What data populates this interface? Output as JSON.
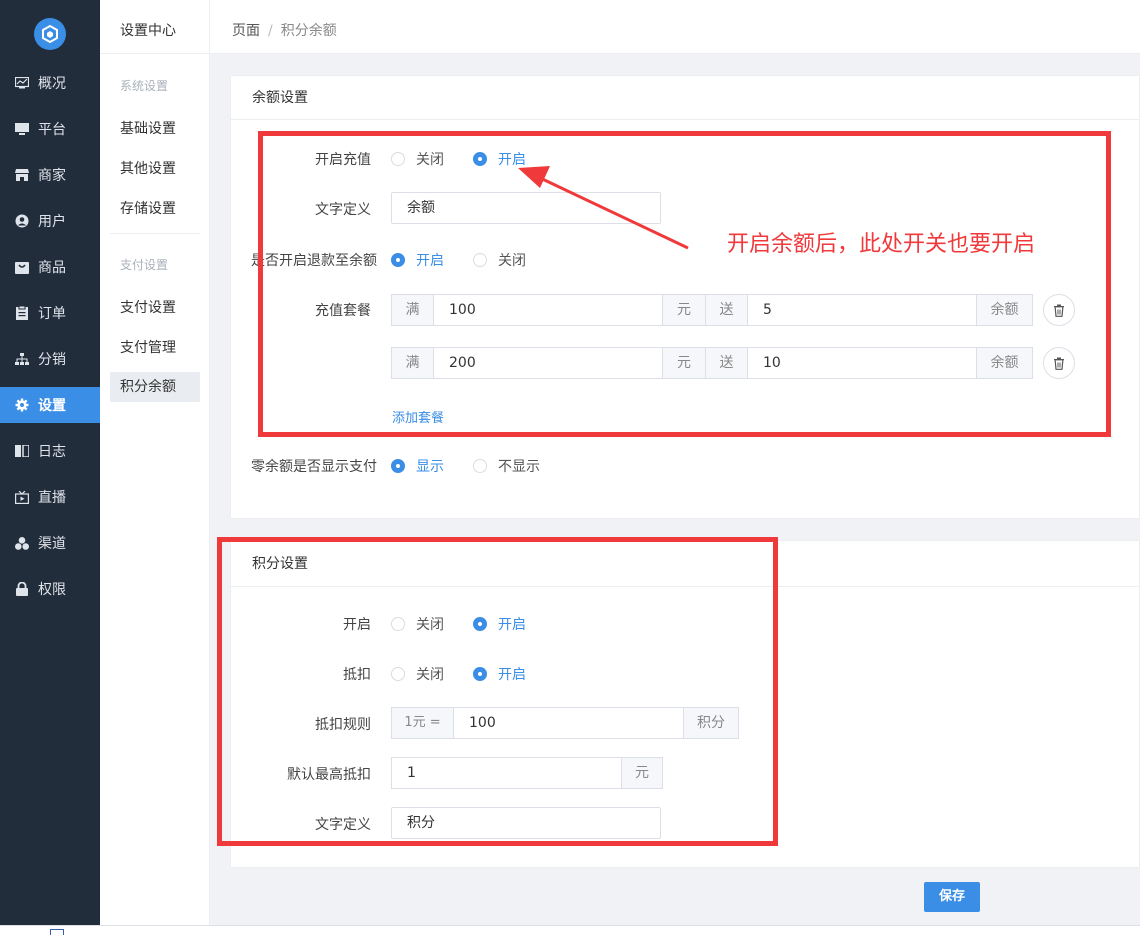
{
  "nav": {
    "items": [
      {
        "label": "概况",
        "icon": "overview-icon"
      },
      {
        "label": "平台",
        "icon": "monitor-icon"
      },
      {
        "label": "商家",
        "icon": "store-icon"
      },
      {
        "label": "用户",
        "icon": "user-icon"
      },
      {
        "label": "商品",
        "icon": "goods-icon"
      },
      {
        "label": "订单",
        "icon": "order-icon"
      },
      {
        "label": "分销",
        "icon": "distribution-icon"
      },
      {
        "label": "设置",
        "icon": "gear-icon"
      },
      {
        "label": "日志",
        "icon": "log-icon"
      },
      {
        "label": "直播",
        "icon": "live-icon"
      },
      {
        "label": "渠道",
        "icon": "channel-icon"
      },
      {
        "label": "权限",
        "icon": "lock-icon"
      }
    ],
    "active_index": 7,
    "accent": "#3a8ee6"
  },
  "subnav": {
    "title": "设置中心",
    "group_system": "系统设置",
    "group_payment": "支付设置",
    "items": [
      "基础设置",
      "其他设置",
      "存储设置",
      "支付设置",
      "支付管理",
      "积分余额"
    ],
    "active": "积分余额"
  },
  "breadcrumb": {
    "root": "页面",
    "separator": "/",
    "current": "积分余额"
  },
  "balance": {
    "title": "余额设置",
    "recharge_label": "开启充值",
    "off": "关闭",
    "on": "开启",
    "name_label": "文字定义",
    "name_value": "余额",
    "refund_label": "是否开启退款至余额",
    "package_label": "充值套餐",
    "addon_full": "满",
    "addon_yuan": "元",
    "addon_give": "送",
    "addon_balance": "余额",
    "packages": [
      {
        "full": "100",
        "give": "5"
      },
      {
        "full": "200",
        "give": "10"
      }
    ],
    "add_package": "添加套餐",
    "zero_label": "零余额是否显示支付",
    "show": "显示",
    "hide": "不显示"
  },
  "points": {
    "title": "积分设置",
    "enable_label": "开启",
    "deduct_label": "抵扣",
    "off": "关闭",
    "on": "开启",
    "rule_label": "抵扣规则",
    "rule_prefix": "1元 =",
    "rule_value": "100",
    "rule_suffix": "积分",
    "max_label": "默认最高抵扣",
    "max_value": "1",
    "max_suffix": "元",
    "name_label": "文字定义",
    "name_value": "积分"
  },
  "annotation": "开启余额后，此处开关也要开启",
  "save_label": "保存",
  "highlight_color": "#f0393b"
}
